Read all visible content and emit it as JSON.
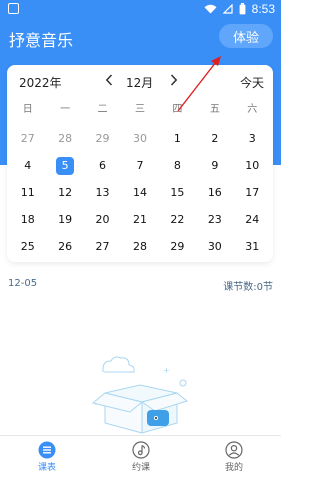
{
  "status": {
    "time": "8:53"
  },
  "header": {
    "title": "抒意音乐",
    "trial_label": "体验"
  },
  "calendar": {
    "year": "2022年",
    "month": "12月",
    "today_label": "今天",
    "weekdays": [
      "日",
      "一",
      "二",
      "三",
      "四",
      "五",
      "六"
    ],
    "weeks": [
      [
        {
          "d": "27",
          "m": true
        },
        {
          "d": "28",
          "m": true
        },
        {
          "d": "29",
          "m": true
        },
        {
          "d": "30",
          "m": true
        },
        {
          "d": "1"
        },
        {
          "d": "2"
        },
        {
          "d": "3"
        }
      ],
      [
        {
          "d": "4"
        },
        {
          "d": "5",
          "s": true
        },
        {
          "d": "6"
        },
        {
          "d": "7"
        },
        {
          "d": "8"
        },
        {
          "d": "9"
        },
        {
          "d": "10"
        }
      ],
      [
        {
          "d": "11"
        },
        {
          "d": "12"
        },
        {
          "d": "13"
        },
        {
          "d": "14"
        },
        {
          "d": "15"
        },
        {
          "d": "16"
        },
        {
          "d": "17"
        }
      ],
      [
        {
          "d": "18"
        },
        {
          "d": "19"
        },
        {
          "d": "20"
        },
        {
          "d": "21"
        },
        {
          "d": "22"
        },
        {
          "d": "23"
        },
        {
          "d": "24"
        }
      ],
      [
        {
          "d": "25"
        },
        {
          "d": "26"
        },
        {
          "d": "27"
        },
        {
          "d": "28"
        },
        {
          "d": "29"
        },
        {
          "d": "30"
        },
        {
          "d": "31"
        }
      ]
    ]
  },
  "schedule": {
    "date": "12-05",
    "count": "课节数:0节"
  },
  "tabs": [
    {
      "label": "课表",
      "icon": "list-icon",
      "active": true
    },
    {
      "label": "约课",
      "icon": "music-note-icon",
      "active": false
    },
    {
      "label": "我的",
      "icon": "profile-icon",
      "active": false
    }
  ],
  "colors": {
    "accent": "#3a8ff7",
    "annotation_arrow": "#e02020"
  }
}
